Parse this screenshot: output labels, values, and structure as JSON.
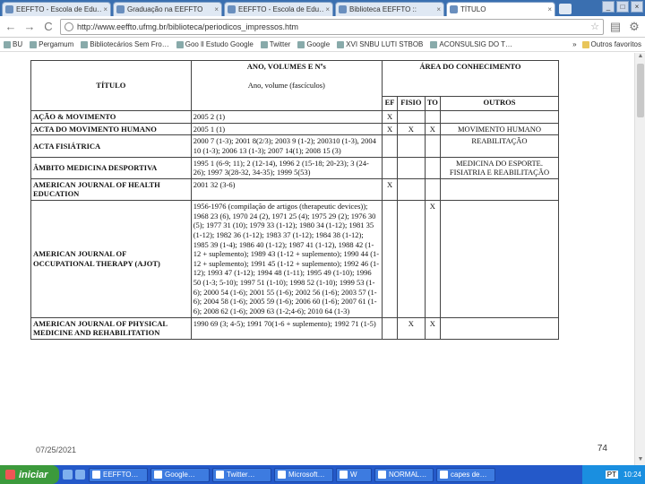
{
  "browser": {
    "tabs": [
      {
        "label": "EEFFTO - Escola de Edu…",
        "active": false
      },
      {
        "label": "Graduação na EEFFTO",
        "active": false
      },
      {
        "label": "EEFFTO - Escola de Edu…",
        "active": false
      },
      {
        "label": "Biblioteca EEFFTO ::",
        "active": false
      },
      {
        "label": "TÍTULO",
        "active": true
      }
    ],
    "url": "http://www.eeffto.ufmg.br/biblioteca/periodicos_impressos.htm",
    "bookmarks": [
      "BU",
      "Pergamum",
      "Bibliotecários Sem Fro…",
      "Goo ll Estudo Google",
      "Twitter",
      "Google",
      "XVI SNBU LUTI STBOB",
      "ACONSULSIG DO T…"
    ],
    "bookmarks_right": "Outros favoritos",
    "nav_symbols": {
      "back": "←",
      "forward": "→",
      "reload": "C"
    }
  },
  "table": {
    "headers": {
      "title": "TÍTULO",
      "ano_volumes": "ANO, VOLUMES E Nºs",
      "ano_volume_sub": "Ano, volume (fascículos)",
      "area": "ÁREA DO CONHECIMENTO",
      "ef": "EF",
      "fisio": "FISIO",
      "to": "TO",
      "outros": "OUTROS"
    },
    "rows": [
      {
        "title": "AÇÃO & MOVIMENTO",
        "ano": "2005 2 (1)",
        "ef": "X",
        "fisio": "",
        "to": "",
        "outros": ""
      },
      {
        "title": "ACTA DO MOVIMENTO HUMANO",
        "ano": "2005 1 (1)",
        "ef": "X",
        "fisio": "X",
        "to": "X",
        "outros": "MOVIMENTO HUMANO"
      },
      {
        "title": "ACTA FISIÁTRICA",
        "ano": "2000 7 (1-3); 2001 8(2/3); 2003 9 (1-2); 200310 (1-3), 2004 10 (1-3); 2006 13 (1-3); 2007 14(1); 2008 15 (3)",
        "ef": "",
        "fisio": "",
        "to": "",
        "outros": "REABILITAÇÃO"
      },
      {
        "title": "ÂMBITO MEDICINA DESPORTIVA",
        "ano": "1995 1 (6-9; 11); 2 (12-14), 1996 2 (15-18; 20-23); 3 (24-26); 1997 3(28-32, 34-35); 1999 5(53)",
        "ef": "",
        "fisio": "",
        "to": "",
        "outros": "MEDICINA DO ESPORTE. FISIATRIA E REABILITAÇÃO"
      },
      {
        "title": "AMERICAN JOURNAL OF HEALTH EDUCATION",
        "ano": "2001 32 (3-6)",
        "ef": "X",
        "fisio": "",
        "to": "",
        "outros": ""
      },
      {
        "title": "AMERICAN JOURNAL OF OCCUPATIONAL THERAPY (AJOT)",
        "ano": "1956-1976 (compilação de artigos (therapeutic devices)); 1968 23 (6), 1970 24 (2), 1971 25 (4); 1975 29 (2); 1976 30 (5); 1977 31 (10); 1979 33 (1-12); 1980 34 (1-12); 1981 35 (1-12); 1982 36 (1-12); 1983 37 (1-12); 1984 38 (1-12); 1985 39 (1-4); 1986 40 (1-12); 1987 41 (1-12), 1988 42 (1-12 + suplemento); 1989 43 (1-12 + suplemento); 1990 44 (1-12 + suplemento); 1991 45 (1-12 + suplemento); 1992 46 (1-12); 1993 47 (1-12); 1994 48 (1-11); 1995 49 (1-10); 1996 50 (1-3; 5-10); 1997 51 (1-10); 1998 52 (1-10); 1999 53 (1-6); 2000 54 (1-6); 2001 55 (1-6); 2002 56 (1-6); 2003 57 (1-6); 2004 58 (1-6); 2005 59 (1-6); 2006 60 (1-6); 2007 61 (1-6); 2008 62 (1-6); 2009 63 (1-2;4-6); 2010 64 (1-3)",
        "ef": "",
        "fisio": "",
        "to": "X",
        "outros": ""
      },
      {
        "title": "AMERICAN JOURNAL OF PHYSICAL MEDICINE AND REHABILITATION",
        "ano": "1990 69 (3; 4-5); 1991 70(1-6 + suplemento); 1992 71 (1-5)",
        "ef": "",
        "fisio": "X",
        "to": "X",
        "outros": ""
      }
    ]
  },
  "overlay": {
    "date": "07/25/2021",
    "slide_number": "74"
  },
  "taskbar": {
    "start_label": "iniciar",
    "tasks": [
      "EEFFTO…",
      "Google…",
      "Twitter…",
      "Microsoft…",
      "W",
      "NORMAL…",
      "capes de…"
    ],
    "language": "PT",
    "clock": "10:24"
  }
}
